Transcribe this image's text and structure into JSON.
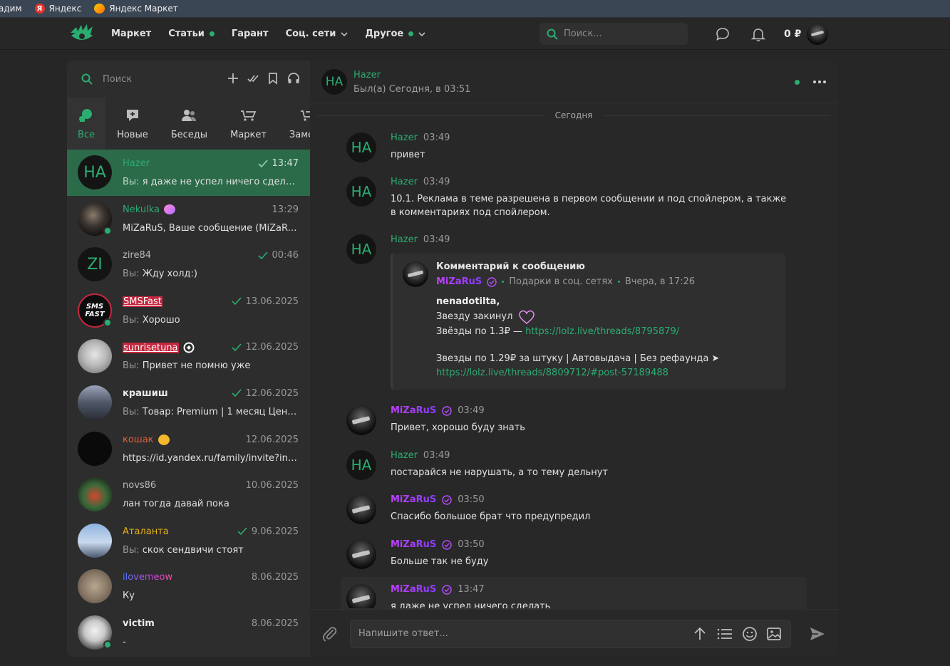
{
  "bookmarks": [
    {
      "label": "адим",
      "icon": ""
    },
    {
      "label": "Яндекс",
      "icon": "yandex-icon"
    },
    {
      "label": "Яндекс Маркет",
      "icon": "yandex-market-icon"
    }
  ],
  "nav": {
    "items": [
      "Маркет",
      "Статьи",
      "Гарант",
      "Соц. сети",
      "Другое"
    ],
    "search_placeholder": "Поиск...",
    "balance": "0 ₽"
  },
  "sidebar": {
    "search_placeholder": "Поиск",
    "tabs": [
      "Все",
      "Новые",
      "Беседы",
      "Маркет",
      "Замены"
    ],
    "chats": [
      {
        "name": "Hazer",
        "avatar_text": "HA",
        "you": "Вы: ",
        "message": "я даже не успел ничего сделать ...",
        "time": "13:47"
      },
      {
        "name": "Nekulka",
        "avatar_text": "",
        "you": "",
        "message": "MiZaRuS, Ваше сообщение (MiZaRuS)...",
        "time": "13:29"
      },
      {
        "name": "zire84",
        "avatar_text": "ZI",
        "you": "Вы: ",
        "message": "Жду холд:)",
        "time": "00:46"
      },
      {
        "name": "SMSFast",
        "avatar_text": "SMS FAST",
        "you": "Вы: ",
        "message": "Хорошо",
        "time": "13.06.2025"
      },
      {
        "name": "sunrisetuna",
        "avatar_text": "",
        "you": "Вы: ",
        "message": "Привет не помню уже",
        "time": "12.06.2025"
      },
      {
        "name": "крашиш",
        "avatar_text": "",
        "you": "Вы: ",
        "message": "Товар: Premium | 1 месяц Цена: ...",
        "time": "12.06.2025"
      },
      {
        "name": "кошак",
        "avatar_text": "",
        "you": "",
        "message": "https://id.yandex.ru/family/invite?invit...",
        "time": "12.06.2025"
      },
      {
        "name": "novs86",
        "avatar_text": "",
        "you": "",
        "message": "лан тогда давай пока",
        "time": "10.06.2025"
      },
      {
        "name": "Аталанта",
        "avatar_text": "",
        "you": "Вы: ",
        "message": "скок сендвичи стоят",
        "time": "9.06.2025"
      },
      {
        "name": "ilovemeow",
        "avatar_text": "",
        "you": "",
        "message": "Ку",
        "time": "8.06.2025"
      },
      {
        "name": "victim",
        "avatar_text": "",
        "you": "",
        "message": "-",
        "time": "8.06.2025"
      }
    ]
  },
  "conversation": {
    "name": "Hazer",
    "avatar_text": "HA",
    "status": "Был(а) Сегодня, в 03:51",
    "date_separator": "Сегодня",
    "messages": [
      {
        "author": "Hazer",
        "time": "03:49",
        "text": "привет"
      },
      {
        "author": "Hazer",
        "time": "03:49",
        "text": "10.1. Реклама в теме разрешена в первом сообщении и под спойлером, а также в комментариях под спойлером."
      },
      {
        "author": "Hazer",
        "time": "03:49",
        "text": ""
      },
      {
        "author": "MiZaRuS",
        "time": "03:49",
        "text": "Привет, хорошо буду знать"
      },
      {
        "author": "Hazer",
        "time": "03:49",
        "text": "постарайся не нарушать, а то тему дельнут"
      },
      {
        "author": "MiZaRuS",
        "time": "03:50",
        "text": "Спасибо большое брат что предупредил"
      },
      {
        "author": "MiZaRuS",
        "time": "03:50",
        "text": "Больше так не буду"
      },
      {
        "author": "MiZaRuS",
        "time": "13:47",
        "text": "я даже не успел ничего сделать"
      }
    ],
    "quote": {
      "title": "Комментарий к сообщению",
      "author": "MiZaRuS",
      "thread": "Подарки в соц. сетях",
      "date": "Вчера, в 17:26",
      "mention": "nenadotilta,",
      "line1": "Звезду закинул",
      "line2_prefix": "Звёзды по 1.3₽ — ",
      "line2_link": "https://lolz.live/threads/8795879/",
      "line3": "Звезды по 1.29₽ за штуку | Автовыдача | Без рефаунда ➤",
      "line4_link": "https://lolz.live/threads/8809712/#post-57189488"
    },
    "composer_placeholder": "Напишите ответ..."
  },
  "colors": {
    "accent": "#2bad72",
    "active_chat": "#2b6b4a",
    "background": "#262626"
  }
}
